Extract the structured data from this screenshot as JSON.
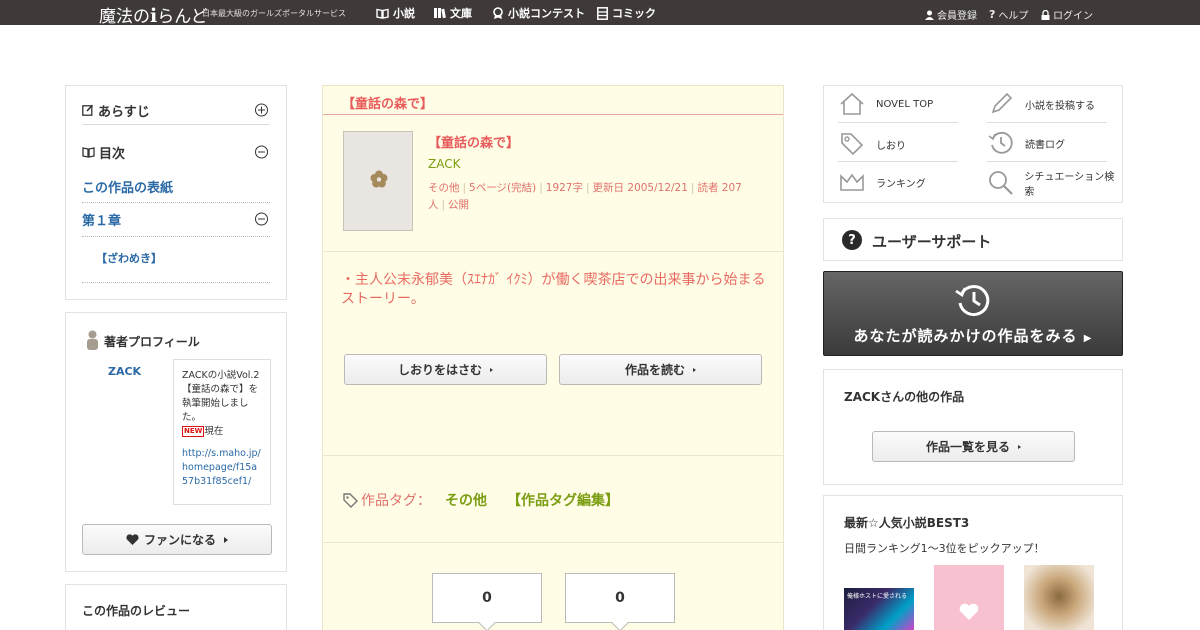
{
  "header": {
    "logo_prefix": "魔法の",
    "logo_i": "i",
    "logo_suffix": "らんど",
    "tagline": "日本最大級のガールズポータルサービス",
    "nav": [
      "小説",
      "文庫",
      "小説コンテスト",
      "コミック"
    ],
    "right": [
      "会員登録",
      "ヘルプ",
      "ログイン"
    ]
  },
  "left": {
    "synopsis_label": "あらすじ",
    "toc_label": "目次",
    "cover_link": "この作品の表紙",
    "chapter1": "第１章",
    "chapter1_item": "【ざわめき】",
    "profile_title": "著者プロフィール",
    "author_name": "ZACK",
    "bubble_text": "ZACKの小説Vol.2【童話の森で】を執筆開始しました。",
    "bubble_new": "NEW",
    "bubble_now": "現在",
    "bubble_url": "http://s.maho.jp/homepage/f15a57b31f85cef1/",
    "fan_button": "ファンになる",
    "review_title": "この作品のレビュー"
  },
  "work": {
    "header_title": "【童話の森で】",
    "title": "【童話の森で】",
    "author": "ZACK",
    "meta": [
      "その他",
      "5ページ(完結)",
      "1927字",
      "更新日 2005/12/21",
      "読者 207人",
      "公開"
    ],
    "summary": "・主人公末永郁美（ｽｴﾅｶﾞ ｲｸﾐ）が働く喫茶店での出来事から始まるストーリー。",
    "bookmark_button": "しおりをはさむ",
    "read_button": "作品を読む",
    "tag_label": "作品タグ：",
    "tag_value": "その他",
    "tag_edit": "【作品タグ編集】",
    "count1": "0",
    "count2": "0"
  },
  "right": {
    "nav": {
      "novel_top": "NOVEL TOP",
      "post": "小説を投稿する",
      "bookmark": "しおり",
      "reading_log": "読書ログ",
      "ranking": "ランキング",
      "situation_search": "シチュエーション検索"
    },
    "support_title": "ユーザーサポート",
    "continue_reading": "あなたが読みかけの作品をみる",
    "other_works_title": "ZACKさんの他の作品",
    "works_list_button": "作品一覧を見る",
    "best3_title": "最新☆人気小説BEST3",
    "best3_sub": "日間ランキング1～3位をピックアップ！",
    "thumb1_caption": "俺様ホストに愛される"
  },
  "colors": {
    "topbar": "#3f3a39",
    "accent_red": "#e85b5b",
    "accent_green": "#7a9d12",
    "link_blue": "#2b6aa6",
    "work_bg": "#fffde6"
  }
}
